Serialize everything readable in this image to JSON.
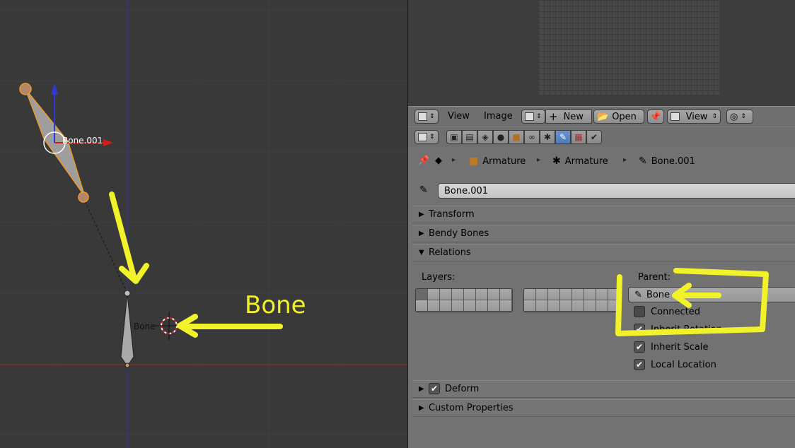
{
  "viewport": {
    "bone_upper_label": "Bone.001",
    "bone_lower_label": "Bone",
    "annotation_text": "Bone"
  },
  "image_header": {
    "view_menu": "View",
    "image_menu": "Image",
    "new_label": "New",
    "open_label": "Open",
    "view_select": "View"
  },
  "breadcrumb": {
    "item1": "Armature",
    "item2": "Armature",
    "item3": "Bone.001"
  },
  "bone_name": "Bone.001",
  "panels": {
    "transform": "Transform",
    "bendy_bones": "Bendy Bones",
    "relations": "Relations",
    "deform": "Deform",
    "custom_properties": "Custom Properties"
  },
  "relations": {
    "layers_label": "Layers:",
    "parent_label": "Parent:",
    "parent_value": "Bone",
    "connected": "Connected",
    "inherit_rotation": "Inherit Rotation",
    "inherit_scale": "Inherit Scale",
    "local_location": "Local Location"
  },
  "colors": {
    "annotation": "#f2f22a",
    "bone_outline": "#f09a2a",
    "active_tab": "#5a86c6"
  }
}
